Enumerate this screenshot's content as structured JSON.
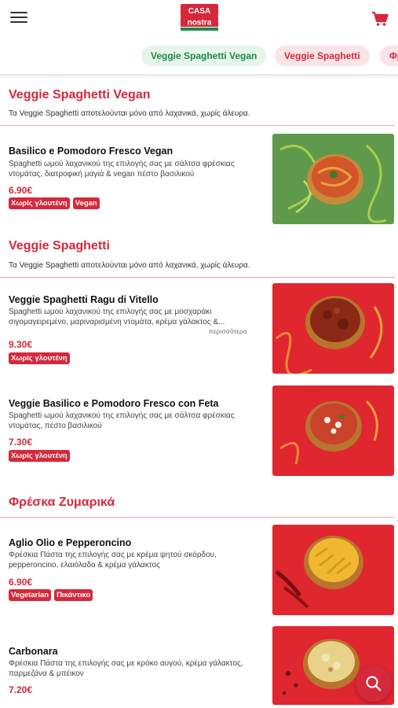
{
  "header": {
    "logo_top": "CASA",
    "logo_bottom": "nostra",
    "menu_icon": "hamburger-menu-icon",
    "cart_icon": "shopping-cart-icon"
  },
  "tabs": [
    {
      "label": "Veggie Spaghetti Vegan"
    },
    {
      "label": "Veggie Spaghetti"
    },
    {
      "label": "Φρ"
    }
  ],
  "colors": {
    "accent": "#d6283b",
    "tab_active_bg": "#e6f4ea",
    "tab_active_text": "#1d8a4a"
  },
  "sections": [
    {
      "title": "Veggie Spaghetti Vegan",
      "description": "Τα Veggie Spaghetti αποτελούνται μόνο από λαχανικά, χωρίς άλευρα.",
      "items": [
        {
          "name": "Basilico e Pomodoro Fresco Vegan",
          "description": "Spaghetti ωμού λαχανικού της επιλογής σας με σάλτσα φρέσκιας ντομάτας, διατροφική μαγιά & vegan πέστο βασιλικού",
          "price": "6.90€",
          "badges": [
            "Χωρίς γλουτένη",
            "Vegan"
          ]
        }
      ]
    },
    {
      "title": "Veggie Spaghetti",
      "description": "Τα Veggie Spaghetti αποτελούνται μόνο από λαχανικά, χωρίς άλευρα.",
      "items": [
        {
          "name": "Veggie Spaghetti Ragu di Vitello",
          "description": "Spaghetti ωμού λαχανικού της επιλογής σας με μοσχαράκι σιγομαγειρεμένο, μαριναρισμένη ντομάτα, κρέμα γάλακτος &...",
          "more": "περισσότερα",
          "price": "9.30€",
          "badges": [
            "Χωρίς γλουτένη"
          ]
        },
        {
          "name": "Veggie Basilico e Pomodoro Fresco con Feta",
          "description": "Spaghetti ωμού λαχανικού της επιλογής σας με σάλτσα φρέσκιας ντομάτας, πέστο βασιλικού",
          "price": "7.30€",
          "badges": [
            "Χωρίς γλουτένη"
          ]
        }
      ]
    },
    {
      "title": "Φρέσκα Ζυμαρικά",
      "items": [
        {
          "name": "Aglio Olio e Pepperoncino",
          "description": "Φρέσκια Πάστα της επιλογής σας με κρέμα ψητού σκόρδου, pepperoncino, ελαιόλαδο & κρέμα γάλακτος",
          "price": "6.90€",
          "badges": [
            "Vegetarian",
            "Πικάντικο"
          ]
        },
        {
          "name": "Carbonara",
          "description": "Φρέσκια Πάστα της επιλογής σας με κρόκο αυγού, κρέμα γάλακτος, παρμεζάνα & μπέικον",
          "price": "7.20€",
          "badges": []
        }
      ]
    }
  ],
  "fab": {
    "icon": "search-icon"
  }
}
